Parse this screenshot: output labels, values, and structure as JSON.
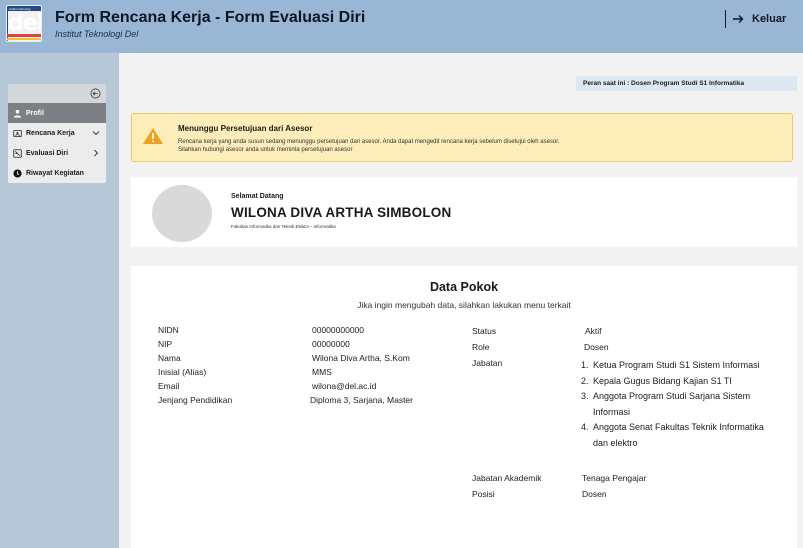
{
  "header": {
    "logo_text": "del",
    "logo_small_text": "institut teknologi",
    "title": "Form Rencana Kerja - Form Evaluasi Diri",
    "subtitle": "Institut Teknologi Del",
    "logout_label": "Keluar"
  },
  "sidebar": {
    "items": [
      {
        "label": "Profil",
        "icon": "user-icon",
        "active": true
      },
      {
        "label": "Rencana Kerja",
        "icon": "clipboard-icon",
        "has_chevron": "down"
      },
      {
        "label": "Evaluasi Diri",
        "icon": "evaluation-icon",
        "has_chevron": "right"
      },
      {
        "label": "Riwayat Kegiatan",
        "icon": "clock-icon"
      }
    ]
  },
  "role_badge": "Peran saat ini  : Dosen Program Studi S1 Informatika",
  "alert": {
    "title": "Menunggu Persetujuan dari Asesor",
    "line1": "Rencana kerja yang anda susun sedang menunggu persetujuan dari asesor. Anda dapat mengedit rencana kerja sebelum disetujui oleh asesor.",
    "line2": "Silahkan hubungi asesor anda untuk meminta persetujuan asesor",
    "color": "#fdeeb9"
  },
  "welcome": {
    "label": "Selamat Datang",
    "name": "WILONA DIVA ARTHA SIMBOLON",
    "faculty": "Fakultas Informatika dan Teknik Elektro - Informatika"
  },
  "data_pokok": {
    "title": "Data Pokok",
    "subtitle": "Jika ingin mengubah data, silahkan lakukan menu terkait",
    "left_fields": [
      {
        "label": "NIDN",
        "value": "00000000000"
      },
      {
        "label": "NIP",
        "value": "00000000"
      },
      {
        "label": "Nama",
        "value": "Wilona Diva Artha, S.Kom"
      },
      {
        "label": "Inisial (Alias)",
        "value": "MMS"
      },
      {
        "label": "Email",
        "value": "wilona@del.ac.id"
      },
      {
        "label": "Jenjang Pendidikan",
        "value": "Diploma 3, Sarjana, Master"
      }
    ],
    "status_label": "Status",
    "status_value": "Aktif",
    "role_label": "Role",
    "role_value": "Dosen",
    "jabatan_label": "Jabatan",
    "jabatan": [
      {
        "num": "1.",
        "text": " Ketua Program Studi S1 Sistem Informasi"
      },
      {
        "num": "2.",
        "text": "Kepala Gugus Bidang  Kajian S1 TI"
      },
      {
        "num": "3.",
        "text": "Anggota Program Studi Sarjana Sistem Informasi"
      },
      {
        "num": "4.",
        "text": "Anggota Senat  Fakultas Teknik Informatika dan elektro"
      }
    ],
    "jabatan_akademik_label": "Jabatan Akademik",
    "jabatan_akademik_value": "Tenaga Pengajar",
    "posisi_label": "Posisi",
    "posisi_value": "Dosen"
  }
}
